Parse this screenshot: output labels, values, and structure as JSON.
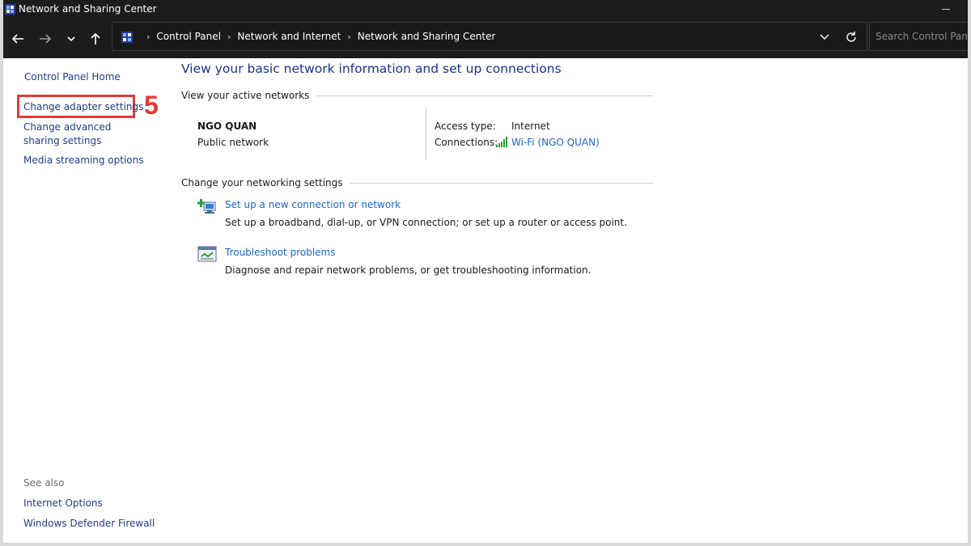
{
  "window": {
    "title": "Network and Sharing Center"
  },
  "navbar": {
    "breadcrumbs": [
      "Control Panel",
      "Network and Internet",
      "Network and Sharing Center"
    ],
    "search_placeholder": "Search Control Panel"
  },
  "leftpane": {
    "links": [
      "Control Panel Home",
      "Change adapter settings",
      "Change advanced sharing settings",
      "Media streaming options"
    ],
    "annotation_step": "5",
    "see_also_label": "See also",
    "see_also_links": [
      "Internet Options",
      "Windows Defender Firewall"
    ]
  },
  "main": {
    "title": "View your basic network information and set up connections",
    "active_networks_heading": "View your active networks",
    "network": {
      "name": "NGO QUAN",
      "category": "Public network",
      "access_type_label": "Access type:",
      "access_type_value": "Internet",
      "connections_label": "Connections:",
      "connection_link": "Wi-Fi (NGO QUAN)"
    },
    "settings_heading": "Change your networking settings",
    "tasks": [
      {
        "link": "Set up a new connection or network",
        "description": "Set up a broadband, dial-up, or VPN connection; or set up a router or access point."
      },
      {
        "link": "Troubleshoot problems",
        "description": "Diagnose and repair network problems, or get troubleshooting information."
      }
    ]
  },
  "icons": {
    "app": "network-center-icon",
    "back": "arrow-left-icon",
    "forward": "arrow-right-icon",
    "recent": "chevron-down-icon",
    "up": "arrow-up-icon",
    "refresh": "refresh-icon",
    "wifi": "wifi-signal-icon",
    "new_connection": "new-connection-icon",
    "troubleshoot": "troubleshoot-icon"
  },
  "colors": {
    "link": "#1e66c2",
    "title": "#1e3287",
    "annotation": "#e53935",
    "chrome": "#1c1c1c"
  }
}
